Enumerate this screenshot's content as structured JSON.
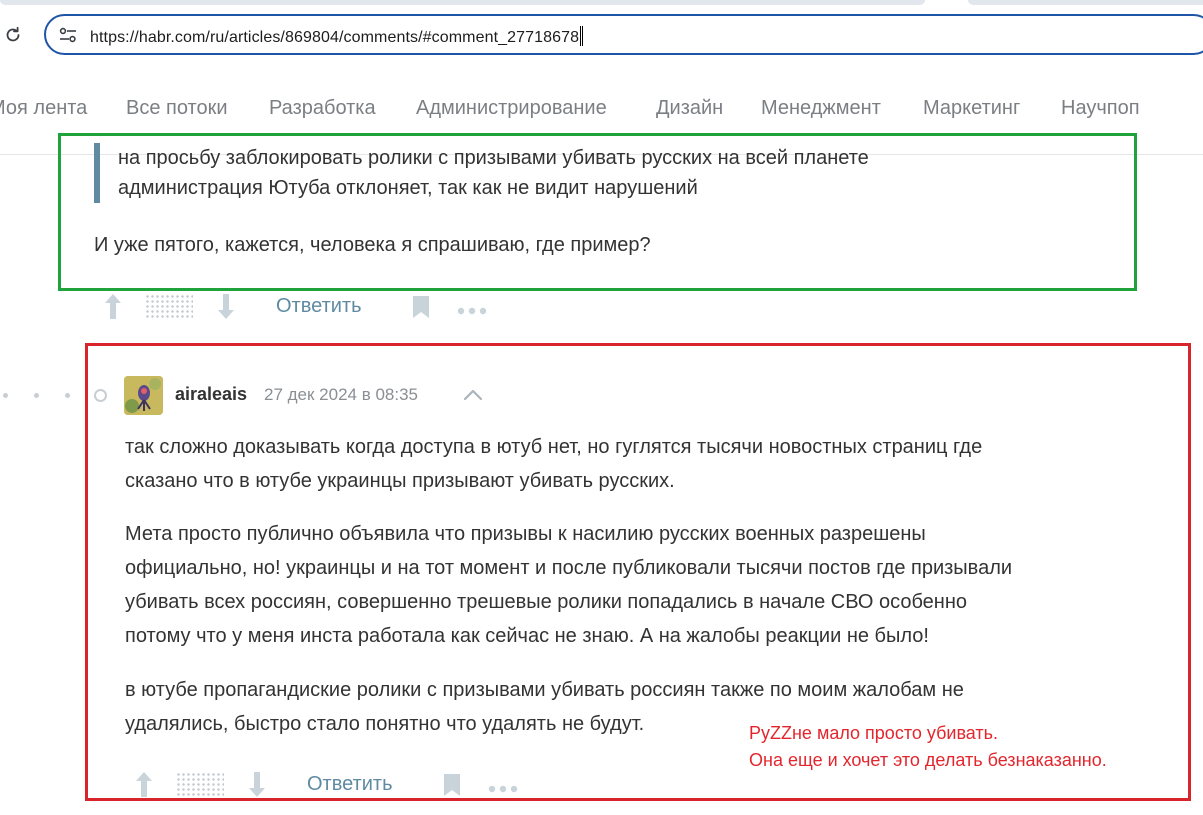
{
  "browser": {
    "url": "https://habr.com/ru/articles/869804/comments/#comment_27718678"
  },
  "nav": {
    "items": [
      "Моя лента",
      "Все потоки",
      "Разработка",
      "Администрирование",
      "Дизайн",
      "Менеджмент",
      "Маркетинг",
      "Научпоп"
    ]
  },
  "comment1": {
    "quote": [
      "на просьбу заблокировать ролики с призывами убивать русских на всей планете",
      "администрация Ютуба отклоняет, так как не видит нарушений"
    ],
    "text": "И уже пятого, кажется, человека я спрашиваю, где пример?",
    "reply_label": "Ответить"
  },
  "comment2": {
    "author": "airaleais",
    "date": "27 дек 2024 в 08:35",
    "paragraphs": [
      [
        "так сложно доказывать когда доступа в ютуб нет, но гуглятся тысячи новостных страниц где",
        "сказано что в ютубе украинцы призывают убивать русских."
      ],
      [
        "Мета просто публично объявила что призывы к насилию русских военных разрешены",
        "официально, но! украинцы и на тот момент и после публиковали тысячи постов где призывали",
        "убивать всех россиян, совершенно трешевые ролики попадались в начале СВО особенно",
        "потому что у меня инста работала как сейчас не знаю. А на жалобы реакции не было!"
      ],
      [
        "в ютубе пропагандиские ролики с призывами убивать россиян также по моим жалобам не",
        "удалялись, быстро стало понятно что удалять не будут."
      ]
    ],
    "reply_label": "Ответить"
  },
  "annotation": {
    "lines": [
      "PyZZне мало просто убивать.",
      "Она еще и хочет это делать безнаказанно."
    ],
    "colors": {
      "green_box": "#1fa33a",
      "red_box": "#d8242b",
      "note_text": "#e3262d"
    }
  }
}
